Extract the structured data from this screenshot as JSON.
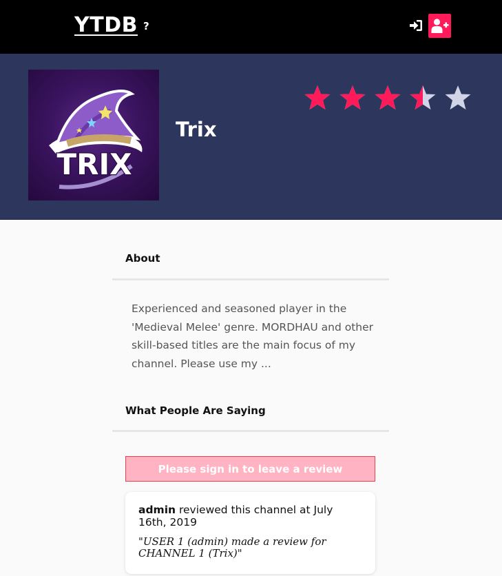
{
  "header": {
    "logo": "YTDB",
    "help": "?",
    "signin_icon": "sign-in-icon",
    "signup_icon": "user-plus-icon",
    "accent": "#ff1a5a"
  },
  "channel": {
    "name": "Trix",
    "logo_text": "TRIX",
    "rating": 3.5,
    "max_rating": 5,
    "star_active_color": "#ff1a5a",
    "star_inactive_color": "#d0d4e6"
  },
  "about": {
    "title": "About",
    "text": "Experienced and seasoned player in the 'Medieval Melee' genre. MORDHAU and other skill-based titles are the main focus of my channel. Please use my ..."
  },
  "reviews": {
    "title": "What People Are Saying",
    "signin_prompt": "Please sign in to leave a review",
    "items": [
      {
        "user": "admin",
        "action": " reviewed this channel at July 16th, 2019",
        "body": "\"USER 1 (admin) made a review for CHANNEL 1 (Trix)\""
      }
    ]
  }
}
